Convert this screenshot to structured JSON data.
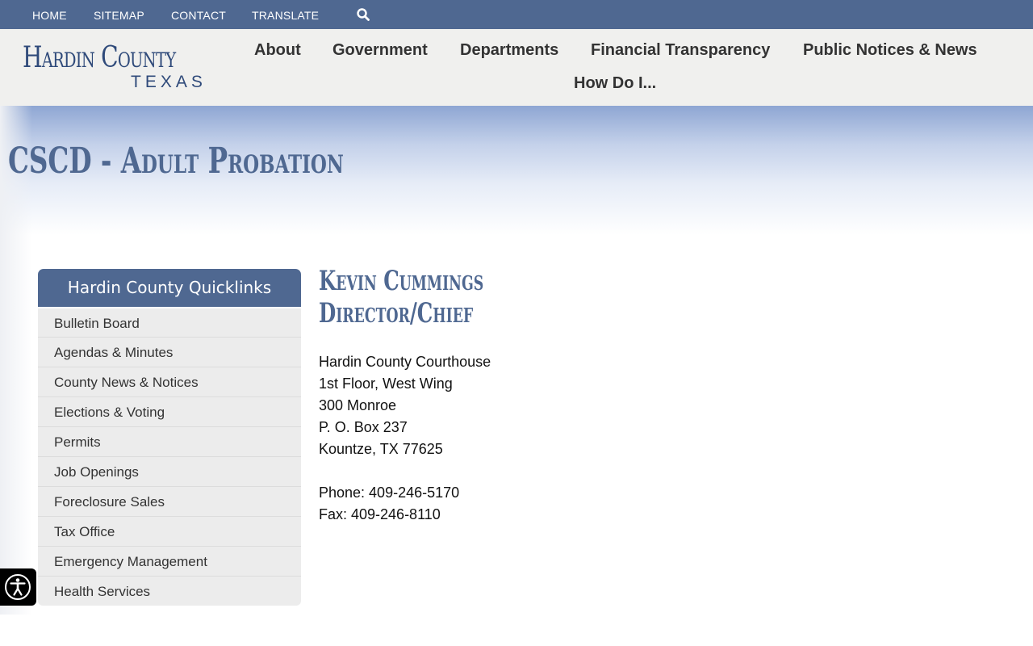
{
  "utility_nav": {
    "home": "HOME",
    "sitemap": "SITEMAP",
    "contact": "CONTACT",
    "translate": "TRANSLATE",
    "search_icon": "search-icon"
  },
  "logo": {
    "name": "Hardin County",
    "state": "TEXAS"
  },
  "main_nav": {
    "about": "About",
    "government": "Government",
    "departments": "Departments",
    "financial_transparency": "Financial Transparency",
    "public_notices": "Public Notices & News",
    "how_do_i": "How Do I..."
  },
  "page": {
    "title": "CSCD - Adult Probation"
  },
  "quicklinks": {
    "header": "Hardin County Quicklinks",
    "items": [
      "Bulletin Board",
      "Agendas & Minutes",
      "County News & Notices",
      "Elections & Voting",
      "Permits",
      "Job Openings",
      "Foreclosure Sales",
      "Tax Office",
      "Emergency Management",
      "Health Services"
    ]
  },
  "contact": {
    "name": "Kevin Cummings",
    "title": "Director/Chief",
    "address": [
      "Hardin County Courthouse",
      "1st Floor, West Wing",
      "300 Monroe",
      "P. O. Box 237",
      "Kountze, TX 77625"
    ],
    "phone": "Phone: 409-246-5170",
    "fax": "Fax: 409-246-8110"
  },
  "colors": {
    "brand_blue": "#4f6891",
    "header_bg": "#f0f0ee",
    "quicklink_bg": "#ececec"
  }
}
